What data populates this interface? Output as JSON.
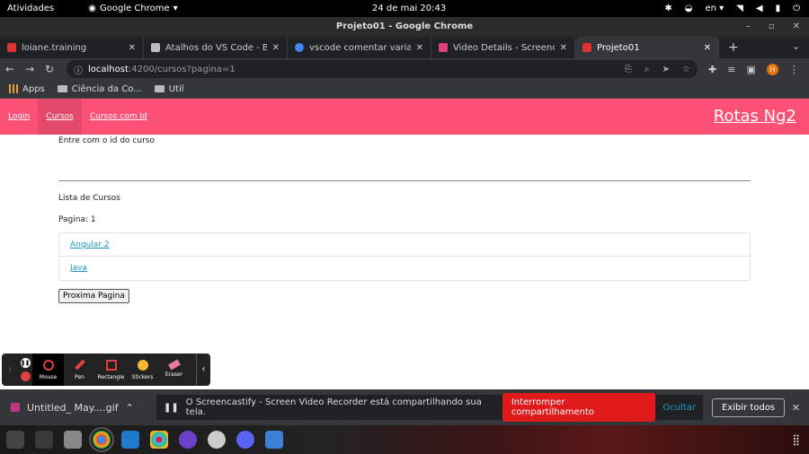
{
  "system": {
    "activities": "Atividades",
    "app_name": "Google Chrome",
    "clock": "24 de mai  20:43",
    "language": "en"
  },
  "window": {
    "title": "Projeto01 - Google Chrome"
  },
  "tabs": [
    {
      "title": "loiane.training",
      "color": "#dd3333"
    },
    {
      "title": "Atalhos do VS Code - Blog",
      "color": "#bbbbbb"
    },
    {
      "title": "vscode comentar varias li",
      "color": "#4285f4"
    },
    {
      "title": "Video Details - Screencas",
      "color": "#e04080"
    },
    {
      "title": "Projeto01",
      "color": "#dd3333"
    }
  ],
  "address_bar": {
    "host": "localhost",
    "path": ":4200/cursos?pagina=1"
  },
  "profile_initial": "H",
  "bookmarks": [
    {
      "label": "Apps"
    },
    {
      "label": "Ciência da Co..."
    },
    {
      "label": "Util"
    }
  ],
  "app": {
    "nav": {
      "login": "Login",
      "cursos": "Cursos",
      "cursos_com_id": "Cursos com Id",
      "brand": "Rotas Ng2"
    },
    "id_prompt": "Entre com o id do curso",
    "list_title": "Lista de Cursos",
    "page_label": "Pagina: 1",
    "courses": [
      "Angular 2",
      "Java"
    ],
    "next_button": "Proxima Pagina",
    "accent_color": "#fd5075"
  },
  "draw_toolbar": {
    "tools": [
      "Mouse",
      "Pen",
      "Rectangle",
      "Stickers",
      "Eraser"
    ]
  },
  "download_bar": {
    "file": "Untitled_ May....gif",
    "share_message": "O Screencastify - Screen Video Recorder está compartilhando sua tela.",
    "stop_label": "Interromper compartilhamento",
    "hide_label": "Ocultar",
    "show_all_label": "Exibir todos"
  }
}
